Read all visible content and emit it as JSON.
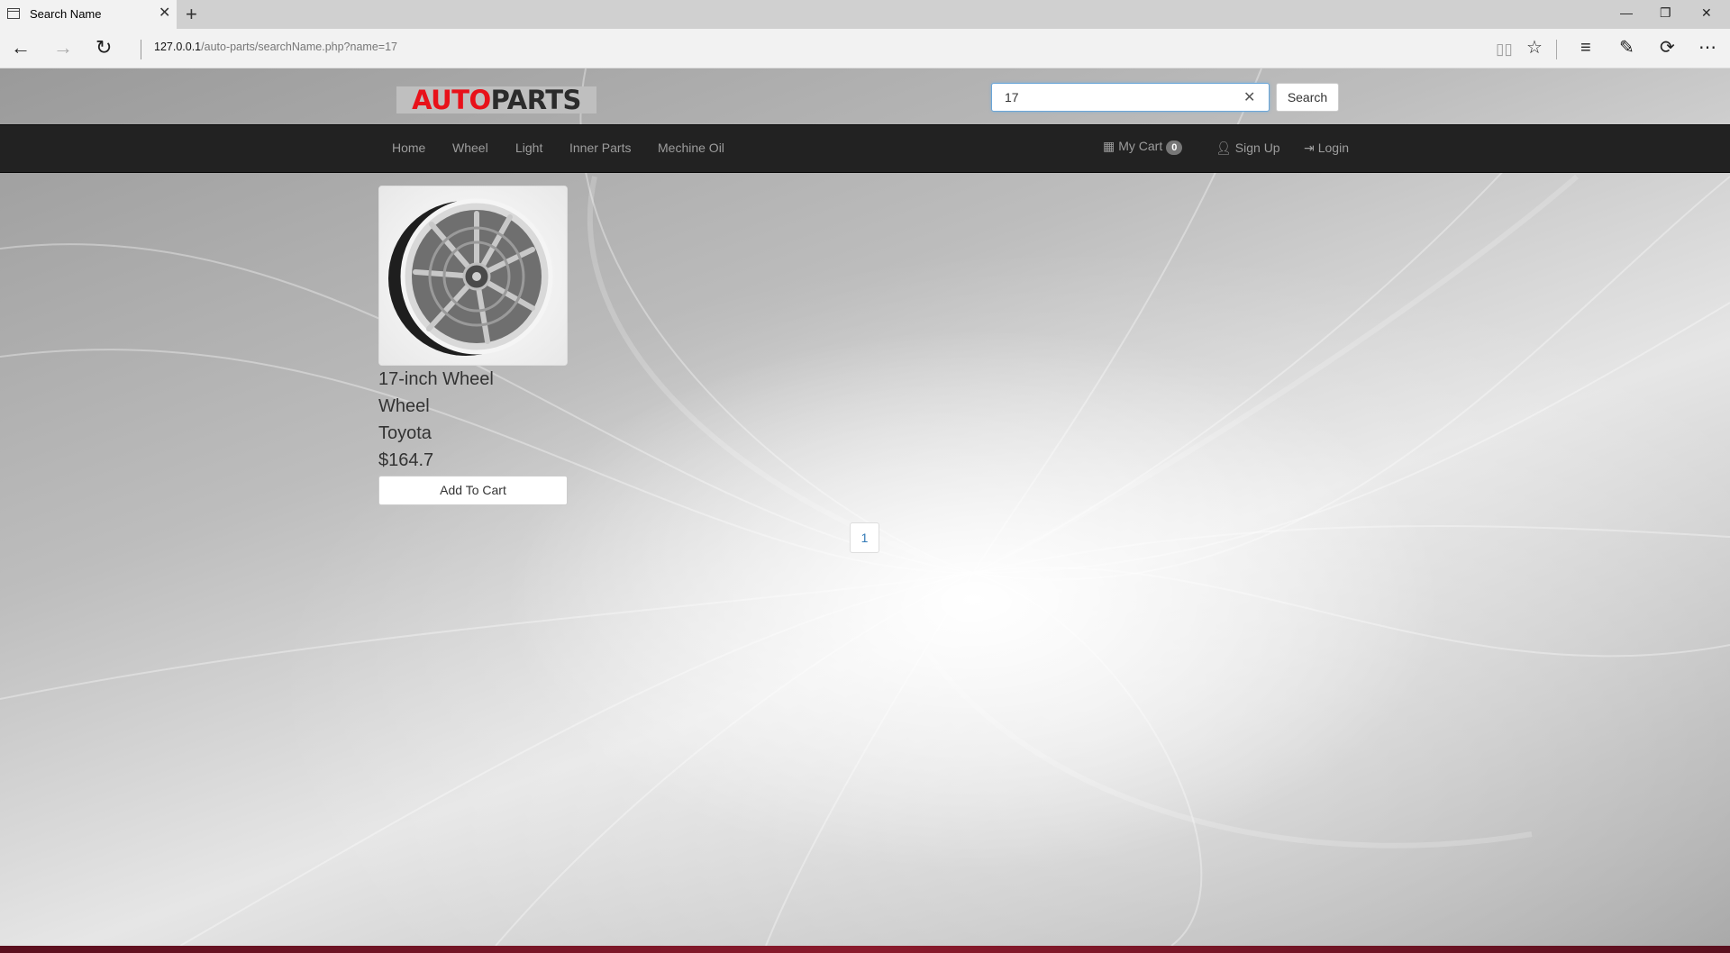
{
  "browser": {
    "tab_title": "Search Name",
    "url_host": "127.0.0.1",
    "url_path": "/auto-parts/searchName.php?name=17"
  },
  "header": {
    "logo_part1": "AUTO",
    "logo_part2": "PARTS",
    "search_value": "17",
    "search_button": "Search"
  },
  "navbar": {
    "items": [
      {
        "label": "Home"
      },
      {
        "label": "Wheel"
      },
      {
        "label": "Light"
      },
      {
        "label": "Inner Parts"
      },
      {
        "label": "Mechine Oil"
      }
    ],
    "cart_label": "My Cart",
    "cart_count": "0",
    "signup_label": "Sign Up",
    "login_label": "Login"
  },
  "product": {
    "name": "17-inch Wheel",
    "category": "Wheel",
    "brand": "Toyota",
    "price": "$164.7",
    "add_to_cart": "Add To Cart"
  },
  "pagination": {
    "pages": [
      "1"
    ]
  },
  "colors": {
    "logo_red": "#e8111a",
    "navbar_bg": "#222222",
    "link_blue": "#337ab7"
  }
}
